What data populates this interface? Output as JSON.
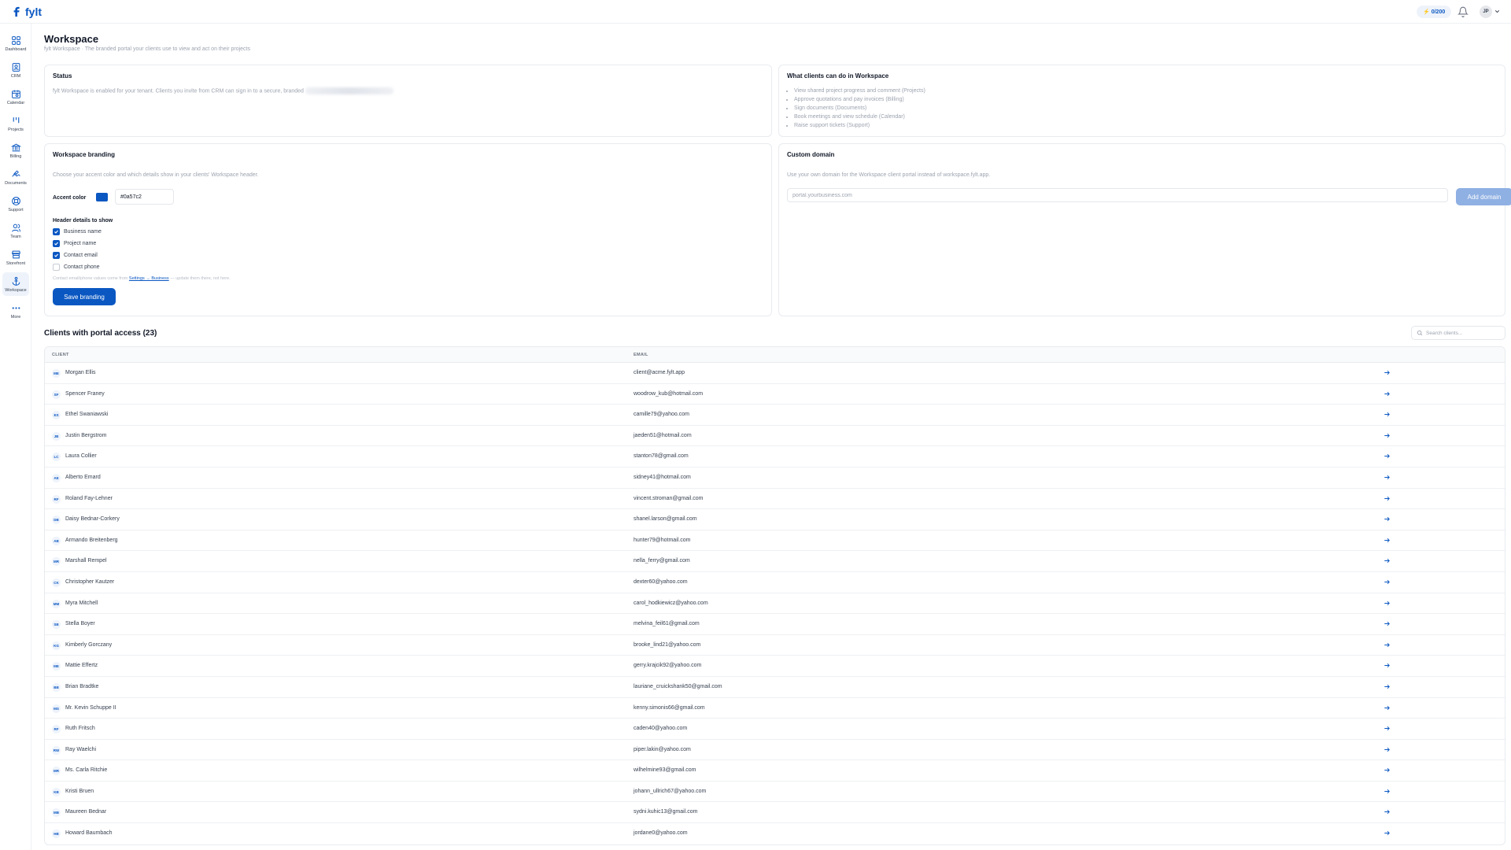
{
  "brand": {
    "name": "fylt"
  },
  "topbar": {
    "credits": "0/200",
    "user_initials": "JP"
  },
  "nav": [
    {
      "label": "Dashboard",
      "icon": "dashboard-icon"
    },
    {
      "label": "CRM",
      "icon": "contact-card-icon"
    },
    {
      "label": "Calendar",
      "icon": "calendar-icon"
    },
    {
      "label": "Projects",
      "icon": "projects-icon"
    },
    {
      "label": "Billing",
      "icon": "bank-icon"
    },
    {
      "label": "Documents",
      "icon": "signature-icon"
    },
    {
      "label": "Support",
      "icon": "lifebuoy-icon"
    },
    {
      "label": "Team",
      "icon": "team-icon"
    },
    {
      "label": "Storefront",
      "icon": "store-icon"
    },
    {
      "label": "Workspace",
      "icon": "anchor-icon",
      "active": true
    },
    {
      "label": "More",
      "icon": "more-icon"
    }
  ],
  "page": {
    "title": "Workspace",
    "subtitle": "fylt Workspace · The branded portal your clients use to view and act on their projects"
  },
  "status_card": {
    "title": "Status",
    "text": "fylt Workspace is enabled for your tenant. Clients you invite from CRM can sign in to a secure, branded"
  },
  "capabilities_card": {
    "title": "What clients can do in Workspace",
    "items": [
      "View shared project progress and comment (Projects)",
      "Approve quotations and pay invoices (Billing)",
      "Sign documents (Documents)",
      "Book meetings and view schedule (Calendar)",
      "Raise support tickets (Support)"
    ]
  },
  "branding_card": {
    "title": "Workspace branding",
    "description": "Choose your accent color and which details show in your clients' Workspace header.",
    "accent_label": "Accent color",
    "accent_value": "#0a57c2",
    "accent_color": "#0a57c2",
    "header_label": "Header details to show",
    "options": [
      {
        "label": "Business name",
        "checked": true
      },
      {
        "label": "Project name",
        "checked": true
      },
      {
        "label": "Contact email",
        "checked": true
      },
      {
        "label": "Contact phone",
        "checked": false
      }
    ],
    "hint_before": "Contact email/phone values come from ",
    "hint_link": "Settings → Business",
    "hint_after": " — update them there, not here.",
    "save_label": "Save branding"
  },
  "domain_card": {
    "title": "Custom domain",
    "description": "Use your own domain for the Workspace client portal instead of workspace.fylt.app.",
    "placeholder": "portal.yourbusiness.com",
    "button": "Add domain"
  },
  "clients": {
    "title": "Clients with portal access (23)",
    "search_placeholder": "Search clients...",
    "headers": {
      "client": "CLIENT",
      "email": "EMAIL"
    },
    "rows": [
      {
        "initials": "ME",
        "name": "Morgan Ellis",
        "email": "client@acme.fylt.app"
      },
      {
        "initials": "SF",
        "name": "Spencer Franey",
        "email": "woodrow_kub@hotmail.com"
      },
      {
        "initials": "ES",
        "name": "Ethel Swaniawski",
        "email": "camille79@yahoo.com"
      },
      {
        "initials": "JB",
        "name": "Justin Bergstrom",
        "email": "jaeden51@hotmail.com"
      },
      {
        "initials": "LC",
        "name": "Laura Collier",
        "email": "stanton78@gmail.com"
      },
      {
        "initials": "AE",
        "name": "Alberto Emard",
        "email": "sidney41@hotmail.com"
      },
      {
        "initials": "RF",
        "name": "Roland Fay-Lehner",
        "email": "vincent.stroman@gmail.com"
      },
      {
        "initials": "DB",
        "name": "Daisy Bednar-Corkery",
        "email": "shanel.larson@gmail.com"
      },
      {
        "initials": "AB",
        "name": "Armando Breitenberg",
        "email": "hunter79@hotmail.com"
      },
      {
        "initials": "MR",
        "name": "Marshall Rempel",
        "email": "nella_ferry@gmail.com"
      },
      {
        "initials": "CK",
        "name": "Christopher Kautzer",
        "email": "dexter60@yahoo.com"
      },
      {
        "initials": "MM",
        "name": "Myra Mitchell",
        "email": "carol_hodkiewicz@yahoo.com"
      },
      {
        "initials": "SB",
        "name": "Stella Boyer",
        "email": "melvina_feil61@gmail.com"
      },
      {
        "initials": "KG",
        "name": "Kimberly Gorczany",
        "email": "brooke_lind21@yahoo.com"
      },
      {
        "initials": "ME",
        "name": "Mattie Effertz",
        "email": "gerry.krajcik92@yahoo.com"
      },
      {
        "initials": "BB",
        "name": "Brian Bradtke",
        "email": "lauriane_cruickshank50@gmail.com"
      },
      {
        "initials": "MS",
        "name": "Mr. Kevin Schuppe II",
        "email": "kenny.simonis66@gmail.com"
      },
      {
        "initials": "RF",
        "name": "Ruth Fritsch",
        "email": "caden40@yahoo.com"
      },
      {
        "initials": "RW",
        "name": "Ray Waelchi",
        "email": "piper.lakin@yahoo.com"
      },
      {
        "initials": "MR",
        "name": "Ms. Carla Ritchie",
        "email": "wilhelmine93@gmail.com"
      },
      {
        "initials": "KB",
        "name": "Kristi Bruen",
        "email": "johann_ullrich67@yahoo.com"
      },
      {
        "initials": "MB",
        "name": "Maureen Bednar",
        "email": "sydni.kuhic13@gmail.com"
      },
      {
        "initials": "HB",
        "name": "Howard Baumbach",
        "email": "jordane0@yahoo.com"
      }
    ]
  }
}
